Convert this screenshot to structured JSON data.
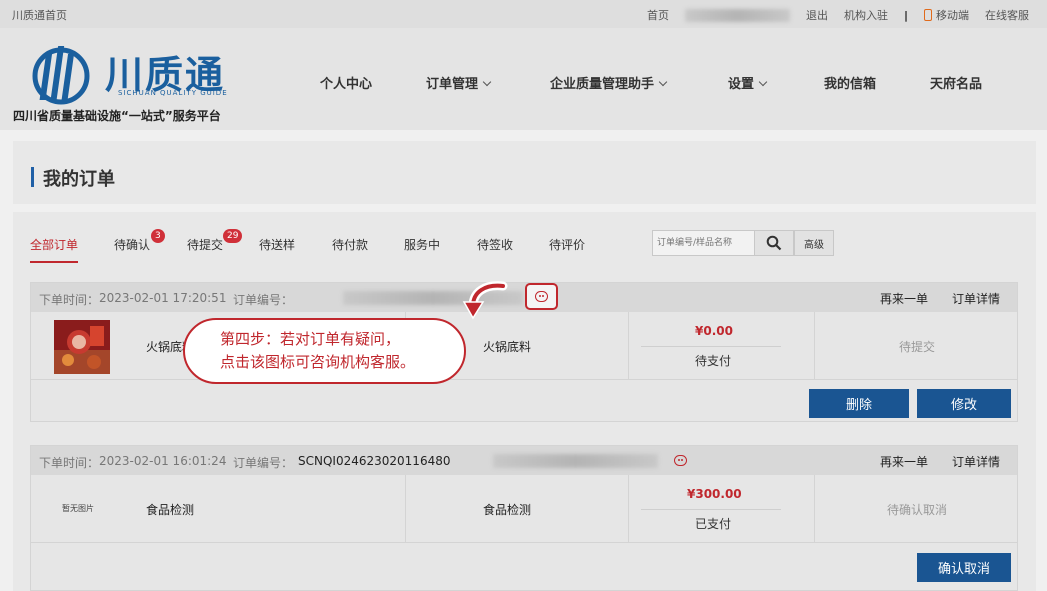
{
  "topbar": {
    "site_home": "川质通首页",
    "home": "首页",
    "logout": "退出",
    "institution_join": "机构入驻",
    "separator": "|",
    "mobile": "移动端",
    "online_service": "在线客服"
  },
  "header": {
    "brand": "川质通",
    "brand_sub": "SICHUAN QUALITY GUIDE",
    "platform": "四川省质量基础设施“一站式”服务平台",
    "nav": [
      "个人中心",
      "订单管理",
      "企业质量管理助手",
      "设置",
      "我的信箱",
      "天府名品"
    ]
  },
  "page_title": "我的订单",
  "tabs": [
    {
      "label": "全部订单"
    },
    {
      "label": "待确认",
      "badge": "3"
    },
    {
      "label": "待提交",
      "badge": "29"
    },
    {
      "label": "待送样"
    },
    {
      "label": "待付款"
    },
    {
      "label": "服务中"
    },
    {
      "label": "待签收"
    },
    {
      "label": "待评价"
    }
  ],
  "search": {
    "placeholder": "订单编号/样品名称",
    "advanced": "高级"
  },
  "orders": [
    {
      "time_label": "下单时间：",
      "time": "2023-02-01 17:20:51",
      "no_label": "订单编号：",
      "no": "",
      "reorder": "再来一单",
      "detail": "订单详情",
      "item_name": "火锅底料",
      "item_name_2": "火锅底料",
      "price": "¥0.00",
      "pay_status": "待支付",
      "status": "待提交",
      "btn_delete": "删除",
      "btn_edit": "修改"
    },
    {
      "time_label": "下单时间：",
      "time": "2023-02-01 16:01:24",
      "no_label": "订单编号：",
      "no": "SCNQI024623020116480",
      "reorder": "再来一单",
      "detail": "订单详情",
      "no_image": "暂无图片",
      "item_name": "食品检测",
      "item_name_2": "食品检测",
      "price": "¥300.00",
      "pay_status": "已支付",
      "status": "待确认取消",
      "btn_confirm": "确认取消"
    }
  ],
  "callout": {
    "line1": "第四步：若对订单有疑问，",
    "line2": "点击该图标可咨询机构客服。"
  },
  "colors": {
    "accent_red": "#c0272d",
    "brand_blue": "#1a5f9e",
    "button_blue": "#1a5592"
  }
}
